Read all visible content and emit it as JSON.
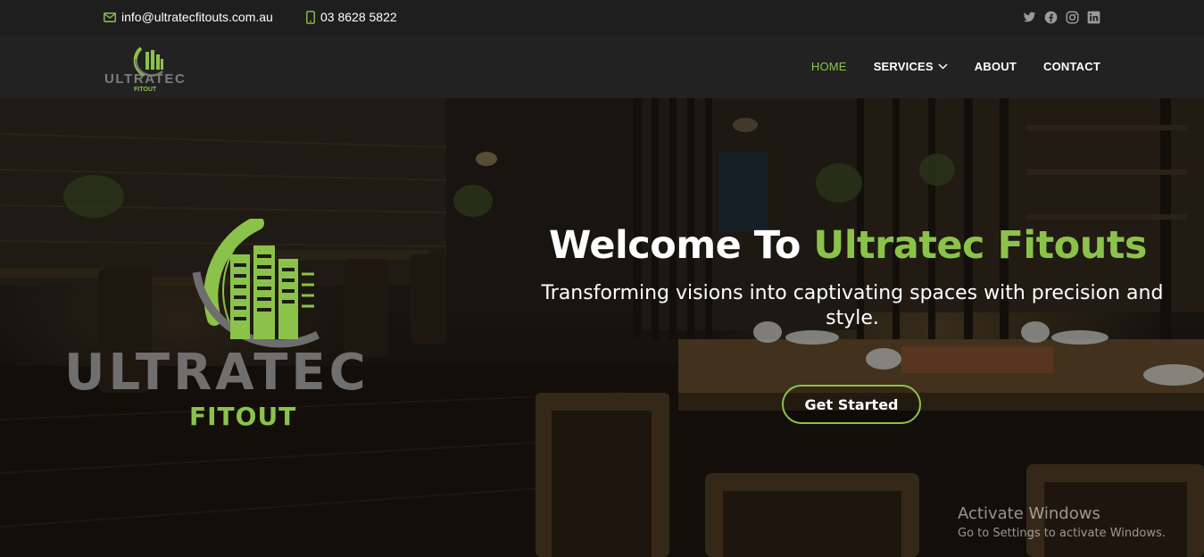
{
  "topbar": {
    "email": "info@ultratecfitouts.com.au",
    "phone": "03 8628 5822",
    "socials": [
      "twitter-icon",
      "facebook-icon",
      "instagram-icon",
      "linkedin-icon"
    ]
  },
  "logo": {
    "word1": "ULTRATEC",
    "word2": "FITOUT"
  },
  "nav": {
    "home": "HOME",
    "services": "SERVICES",
    "about": "ABOUT",
    "contact": "CONTACT"
  },
  "hero": {
    "title_part1": "Welcome To ",
    "title_part2": "Ultratec Fitouts",
    "tagline": "Transforming visions into captivating spaces with precision and style.",
    "cta": "Get Started"
  },
  "os_watermark": {
    "line1": "Activate Windows",
    "line2": "Go to Settings to activate Windows."
  },
  "colors": {
    "accent": "#8bc34a",
    "dark": "#1e1e1e",
    "logo_gray": "#7a7a7a"
  }
}
